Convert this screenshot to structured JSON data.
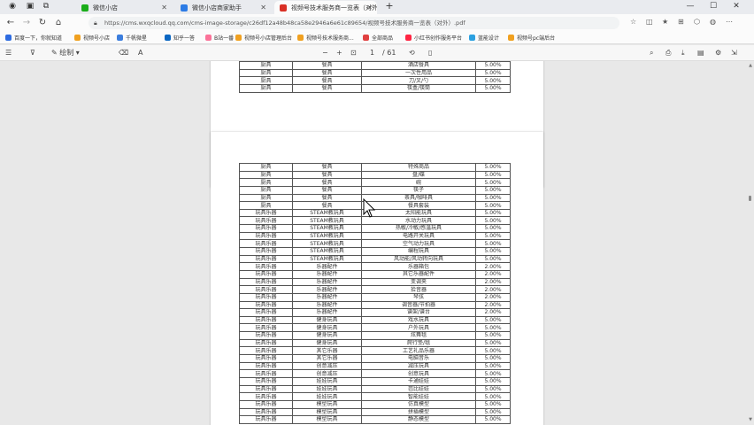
{
  "tabs": [
    {
      "label": "微信小店"
    },
    {
      "label": "微信小店商家助手"
    },
    {
      "label": "视频号技术服务商一览表（对外）"
    }
  ],
  "address": {
    "url": "https://cms.wxqcloud.qq.com/cms-image-storage/c26df12a48b48ca58e2946a6e61c89654/视频号技术服务商一览表（对外）.pdf"
  },
  "favorites": [
    {
      "label": "百度一下，你就知道"
    },
    {
      "label": "视频号小店"
    },
    {
      "label": "千帆微星"
    },
    {
      "label": "知乎一答"
    },
    {
      "label": "B站一番"
    },
    {
      "label": "视频号小店管理后台"
    },
    {
      "label": "视频号技术服务商..."
    },
    {
      "label": "全部商品"
    },
    {
      "label": "小红书创作服务平台"
    },
    {
      "label": "蓝能设计"
    },
    {
      "label": "视频号pc端后台"
    }
  ],
  "pdf_toolbar": {
    "draw_label": "绘制",
    "page_current": "1",
    "page_total": "/ 61"
  },
  "table_top": [
    [
      "厨具",
      "餐具",
      "酒店餐具",
      "5.00%"
    ],
    [
      "厨具",
      "餐具",
      "一次性用品",
      "5.00%"
    ],
    [
      "厨具",
      "餐具",
      "刀/叉/勺",
      "5.00%"
    ],
    [
      "厨具",
      "餐具",
      "筷盒/筷筒",
      "5.00%"
    ]
  ],
  "table_main": [
    [
      "厨具",
      "餐具",
      "特殊商品",
      "5.00%"
    ],
    [
      "厨具",
      "餐具",
      "盘/碟",
      "5.00%"
    ],
    [
      "厨具",
      "餐具",
      "碗",
      "5.00%"
    ],
    [
      "厨具",
      "餐具",
      "筷子",
      "5.00%"
    ],
    [
      "厨具",
      "餐具",
      "茶具/咖啡具",
      "5.00%"
    ],
    [
      "厨具",
      "餐具",
      "餐具套装",
      "5.00%"
    ],
    [
      "玩具乐器",
      "STEAM教玩具",
      "太阳能玩具",
      "5.00%"
    ],
    [
      "玩具乐器",
      "STEAM教玩具",
      "水动力玩具",
      "5.00%"
    ],
    [
      "玩具乐器",
      "STEAM教玩具",
      "热敏/冷敏/感温玩具",
      "5.00%"
    ],
    [
      "玩具乐器",
      "STEAM教玩具",
      "电路开关玩具",
      "5.00%"
    ],
    [
      "玩具乐器",
      "STEAM教玩具",
      "空气动力玩具",
      "5.00%"
    ],
    [
      "玩具乐器",
      "STEAM教玩具",
      "编程玩具",
      "5.00%"
    ],
    [
      "玩具乐器",
      "STEAM教玩具",
      "风动能/风动转向玩具",
      "5.00%"
    ],
    [
      "玩具乐器",
      "乐器配件",
      "乐器箱包",
      "2.00%"
    ],
    [
      "玩具乐器",
      "乐器配件",
      "其它乐器配件",
      "2.00%"
    ],
    [
      "玩具乐器",
      "乐器配件",
      "变调夹",
      "2.00%"
    ],
    [
      "玩具乐器",
      "乐器配件",
      "拾音器",
      "2.00%"
    ],
    [
      "玩具乐器",
      "乐器配件",
      "琴弦",
      "2.00%"
    ],
    [
      "玩具乐器",
      "乐器配件",
      "调音器/节拍器",
      "2.00%"
    ],
    [
      "玩具乐器",
      "乐器配件",
      "谱架/谱台",
      "2.00%"
    ],
    [
      "玩具乐器",
      "健身玩具",
      "戏水玩具",
      "5.00%"
    ],
    [
      "玩具乐器",
      "健身玩具",
      "户外玩具",
      "5.00%"
    ],
    [
      "玩具乐器",
      "健身玩具",
      "炫舞毯",
      "5.00%"
    ],
    [
      "玩具乐器",
      "健身玩具",
      "爬行垫/毯",
      "5.00%"
    ],
    [
      "玩具乐器",
      "其它乐器",
      "工艺礼品乐器",
      "5.00%"
    ],
    [
      "玩具乐器",
      "其它乐器",
      "电脑音乐",
      "5.00%"
    ],
    [
      "玩具乐器",
      "创意减压",
      "减压玩具",
      "5.00%"
    ],
    [
      "玩具乐器",
      "创意减压",
      "创意玩具",
      "5.00%"
    ],
    [
      "玩具乐器",
      "娃娃玩具",
      "卡通娃娃",
      "5.00%"
    ],
    [
      "玩具乐器",
      "娃娃玩具",
      "芭比娃娃",
      "5.00%"
    ],
    [
      "玩具乐器",
      "娃娃玩具",
      "智能娃娃",
      "5.00%"
    ],
    [
      "玩具乐器",
      "模型玩具",
      "仿真模型",
      "5.00%"
    ],
    [
      "玩具乐器",
      "模型玩具",
      "拼插模型",
      "5.00%"
    ],
    [
      "玩具乐器",
      "模型玩具",
      "静态模型",
      "5.00%"
    ]
  ],
  "colors": {
    "tab_bg": "#e9ebef",
    "page_bg": "#ffffff",
    "viewer_bg": "#e8e8e8"
  }
}
